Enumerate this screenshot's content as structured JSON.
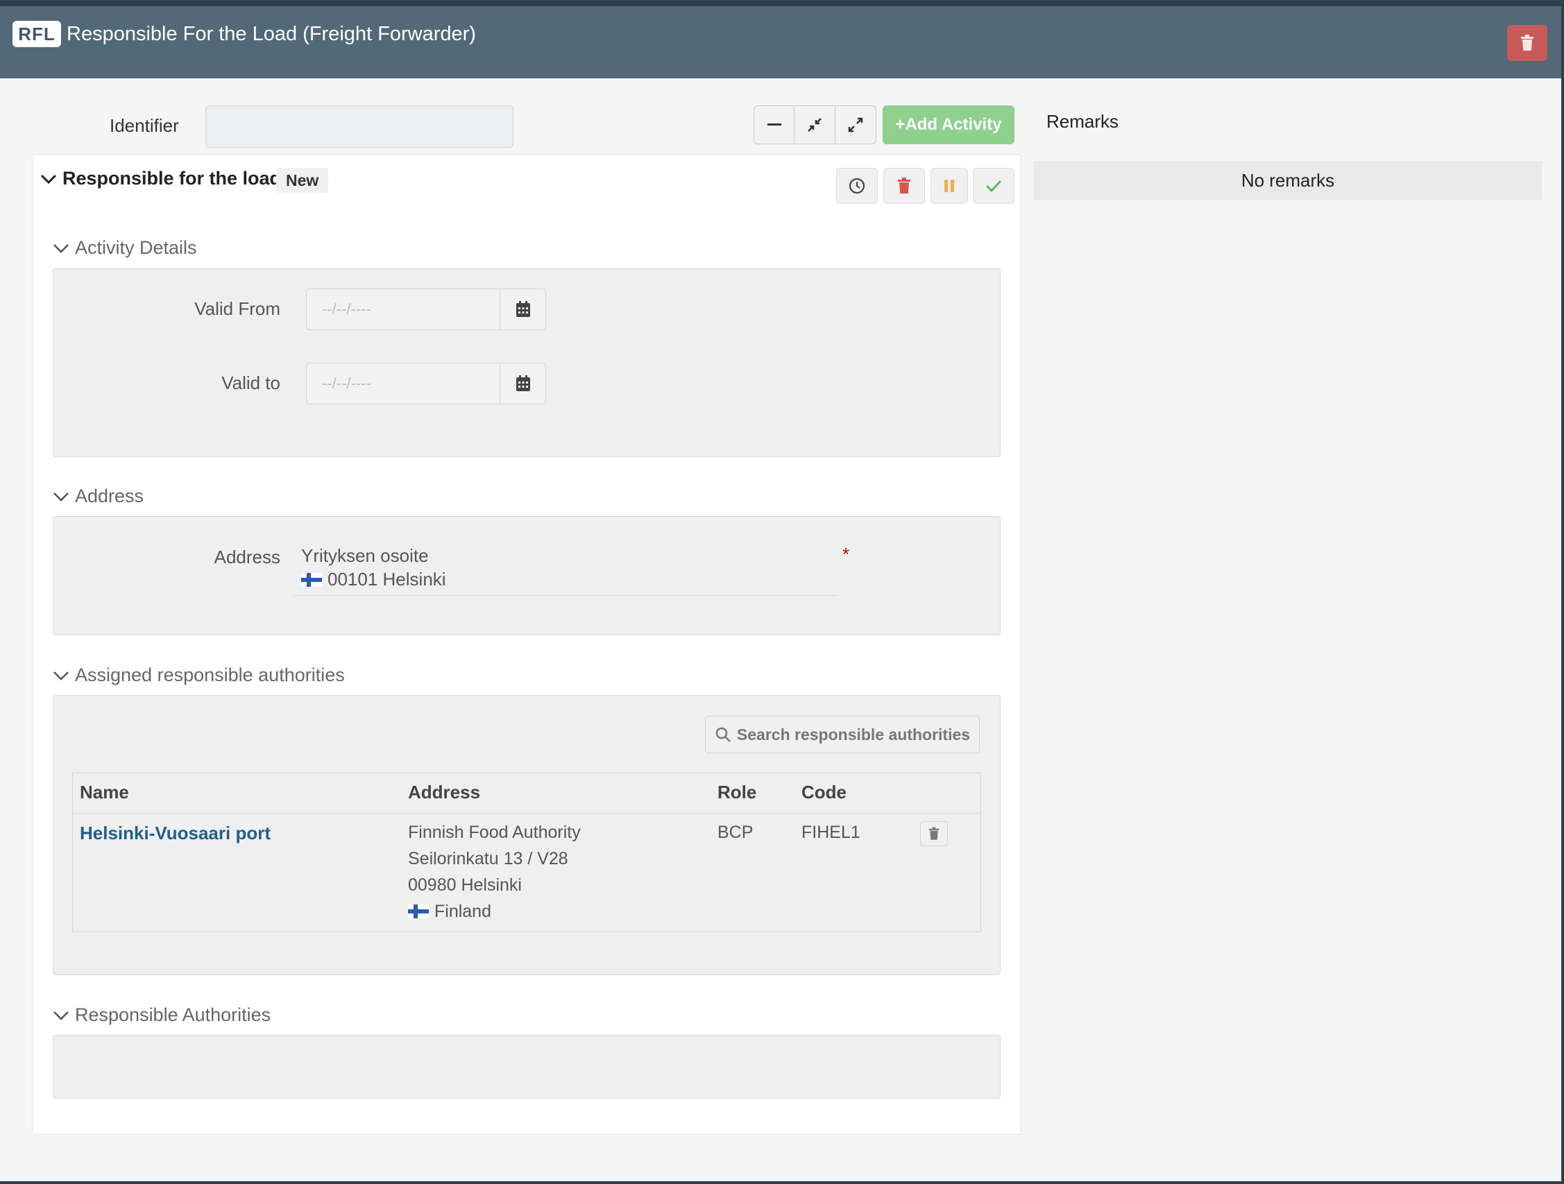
{
  "header": {
    "badge": "RFL",
    "title": "Responsible For the Load (Freight Forwarder)"
  },
  "toolbar": {
    "identifier_label": "Identifier",
    "identifier_value": "",
    "add_activity_label": "+Add Activity",
    "collapse_icon": "minus-icon",
    "shrink_icon": "compress-icon",
    "expand_icon": "expand-icon"
  },
  "remarks": {
    "label": "Remarks",
    "empty_text": "No remarks"
  },
  "activity": {
    "title": "Responsible for the load",
    "status_badge": "New",
    "actions": [
      "history-icon",
      "trash-icon",
      "pause-icon",
      "check-icon"
    ],
    "sections": {
      "details": {
        "title": "Activity Details",
        "valid_from_label": "Valid From",
        "valid_from_placeholder": "--/--/----",
        "valid_to_label": "Valid to",
        "valid_to_placeholder": "--/--/----"
      },
      "address": {
        "title": "Address",
        "label": "Address",
        "line1": "Yrityksen osoite",
        "line2": "00101 Helsinki",
        "required_mark": "*"
      },
      "assigned": {
        "title": "Assigned responsible authorities",
        "search_label": "Search responsible authorities",
        "columns": [
          "Name",
          "Address",
          "Role",
          "Code"
        ],
        "rows": [
          {
            "name": "Helsinki-Vuosaari port",
            "address": [
              "Finnish Food Authority",
              "Seilorinkatu 13 / V28",
              "00980 Helsinki",
              "Finland"
            ],
            "role": "BCP",
            "code": "FIHEL1"
          }
        ]
      },
      "responsible": {
        "title": "Responsible Authorities"
      }
    }
  },
  "colors": {
    "header_bg": "#526977",
    "add_activity": "#8fd08f",
    "danger": "#c85a5a",
    "pause": "#f0ad4e",
    "success": "#5cb85c",
    "link": "#1f5f8b"
  }
}
